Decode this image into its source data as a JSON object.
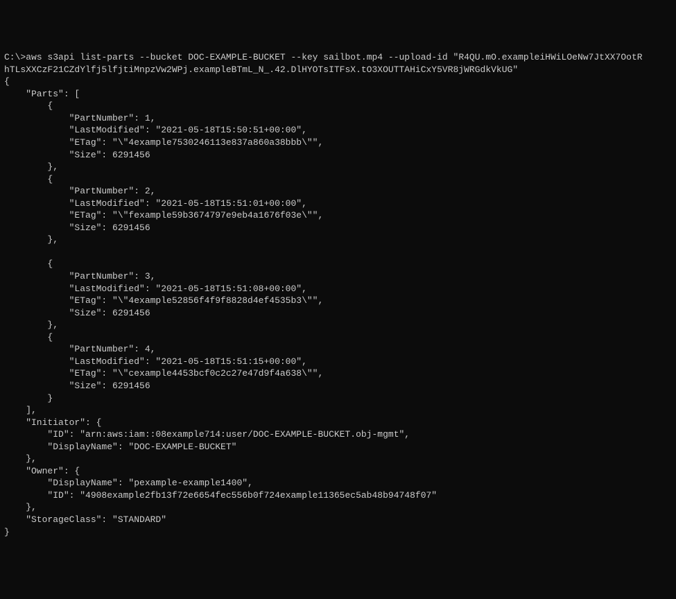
{
  "command": {
    "prompt": "C:\\>",
    "line1": "aws s3api list-parts --bucket DOC-EXAMPLE-BUCKET --key sailbot.mp4 --upload-id \"R4QU.mO.exampleiHWiLOeNw7JtXX7OotR",
    "line2": "hTLsXXCzF21CZdYlfj5lfjtiMnpzVw2WPj.exampleBTmL_N_.42.DlHYOTsITFsX.tO3XOUTTAHiCxY5VR8jWRGdkVkUG\""
  },
  "response": {
    "open_brace": "{",
    "parts_key": "    \"Parts\": [",
    "parts": [
      {
        "open": "        {",
        "partNumber": "            \"PartNumber\": 1,",
        "lastModified": "            \"LastModified\": \"2021-05-18T15:50:51+00:00\",",
        "etag": "            \"ETag\": \"\\\"4example7530246113e837a860a38bbb\\\"\",",
        "size": "            \"Size\": 6291456",
        "close": "        },"
      },
      {
        "open": "        {",
        "partNumber": "            \"PartNumber\": 2,",
        "lastModified": "            \"LastModified\": \"2021-05-18T15:51:01+00:00\",",
        "etag": "            \"ETag\": \"\\\"fexample59b3674797e9eb4a1676f03e\\\"\",",
        "size": "            \"Size\": 6291456",
        "close": "        },"
      },
      {
        "open": "        {",
        "partNumber": "            \"PartNumber\": 3,",
        "lastModified": "            \"LastModified\": \"2021-05-18T15:51:08+00:00\",",
        "etag": "            \"ETag\": \"\\\"4example52856f4f9f8828d4ef4535b3\\\"\",",
        "size": "            \"Size\": 6291456",
        "close": "        },"
      },
      {
        "open": "        {",
        "partNumber": "            \"PartNumber\": 4,",
        "lastModified": "            \"LastModified\": \"2021-05-18T15:51:15+00:00\",",
        "etag": "            \"ETag\": \"\\\"cexample4453bcf0c2c27e47d9f4a638\\\"\",",
        "size": "            \"Size\": 6291456",
        "close": "        }"
      }
    ],
    "parts_close": "    ],",
    "initiator_open": "    \"Initiator\": {",
    "initiator_id": "        \"ID\": \"arn:aws:iam::08example714:user/DOC-EXAMPLE-BUCKET.obj-mgmt\",",
    "initiator_displayName": "        \"DisplayName\": \"DOC-EXAMPLE-BUCKET\"",
    "initiator_close": "    },",
    "owner_open": "    \"Owner\": {",
    "owner_displayName": "        \"DisplayName\": \"pexample-example1400\",",
    "owner_id": "        \"ID\": \"4908example2fb13f72e6654fec556b0f724example11365ec5ab48b94748f07\"",
    "owner_close": "    },",
    "storageClass": "    \"StorageClass\": \"STANDARD\"",
    "close_brace": "}"
  }
}
